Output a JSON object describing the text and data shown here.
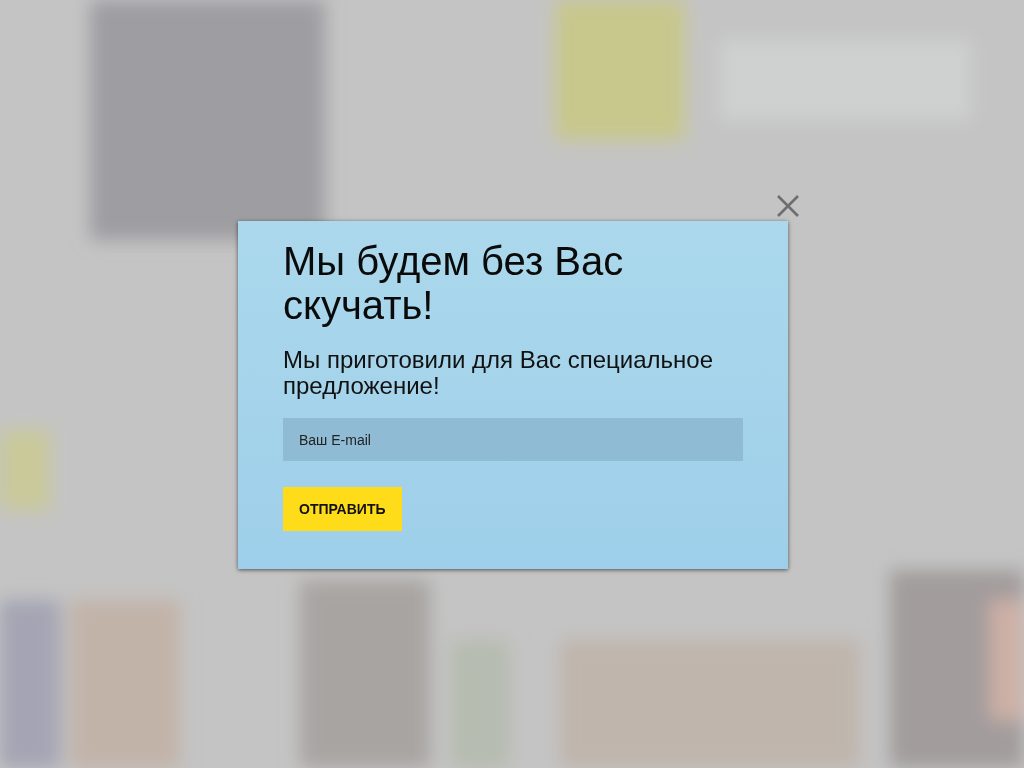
{
  "popup": {
    "title": "Мы будем без Вас скучать!",
    "subtitle": "Мы приготовили для Вас специальное предложение!",
    "email_field": {
      "placeholder": "Ваш E-mail"
    },
    "submit_button": "ОТПРАВИТЬ"
  }
}
